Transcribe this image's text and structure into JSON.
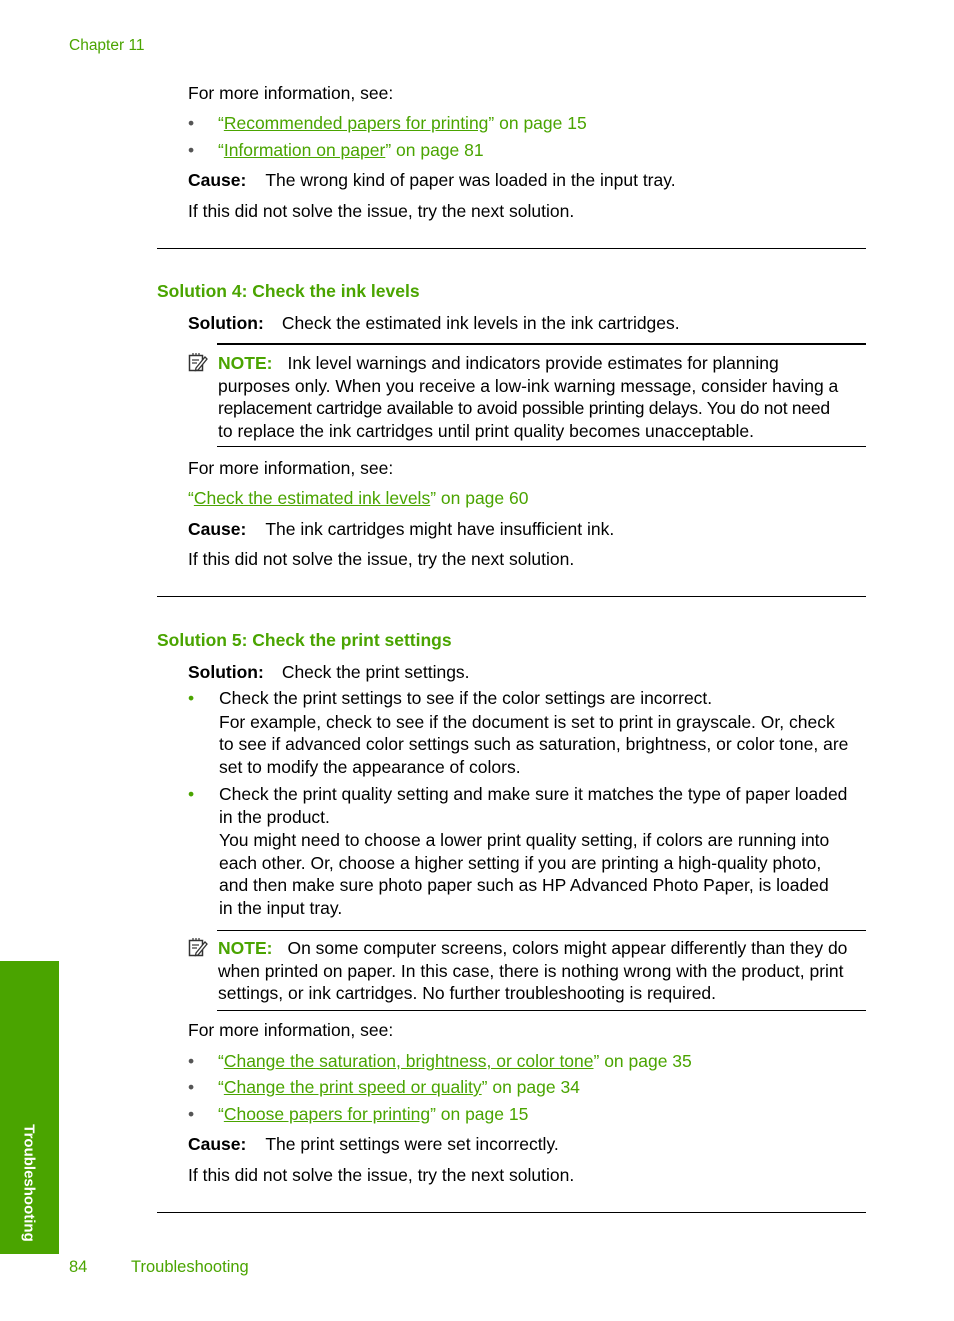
{
  "header": {
    "chapter": "Chapter 11"
  },
  "section_top": {
    "more_info": "For more information, see:",
    "links": [
      {
        "open": "“",
        "link": "Recommended papers for printing",
        "rest": "” on page 15"
      },
      {
        "open": "“",
        "link": "Information on paper",
        "rest": "” on page 81"
      }
    ],
    "cause_label": "Cause:",
    "cause_text": "The wrong kind of paper was loaded in the input tray.",
    "next": "If this did not solve the issue, try the next solution."
  },
  "solution4": {
    "heading": "Solution 4: Check the ink levels",
    "solution_label": "Solution:",
    "solution_text": "Check the estimated ink levels in the ink cartridges.",
    "note_label": "NOTE:",
    "note_lines": [
      "Ink level warnings and indicators provide estimates for planning",
      "purposes only. When you receive a low-ink warning message, consider having a",
      "replacement cartridge available to avoid possible printing delays. You do not need",
      "to replace the ink cartridges until print quality becomes unacceptable."
    ],
    "more_info": "For more information, see:",
    "link": {
      "open": "“",
      "link": "Check the estimated ink levels",
      "rest": "” on page 60"
    },
    "cause_label": "Cause:",
    "cause_text": "The ink cartridges might have insufficient ink.",
    "next": "If this did not solve the issue, try the next solution."
  },
  "solution5": {
    "heading": "Solution 5: Check the print settings",
    "solution_label": "Solution:",
    "solution_text": "Check the print settings.",
    "bullets": [
      {
        "first": "Check the print settings to see if the color settings are incorrect.",
        "detail": [
          "For example, check to see if the document is set to print in grayscale. Or, check",
          "to see if advanced color settings such as saturation, brightness, or color tone, are",
          "set to modify the appearance of colors."
        ]
      },
      {
        "first_lines": [
          "Check the print quality setting and make sure it matches the type of paper loaded",
          "in the product."
        ],
        "detail": [
          "You might need to choose a lower print quality setting, if colors are running into",
          "each other. Or, choose a higher setting if you are printing a high-quality photo,",
          "and then make sure photo paper such as HP Advanced Photo Paper, is loaded",
          "in the input tray."
        ]
      }
    ],
    "note_label": "NOTE:",
    "note_lines": [
      "On some computer screens, colors might appear differently than they do",
      "when printed on paper. In this case, there is nothing wrong with the product, print",
      "settings, or ink cartridges. No further troubleshooting is required."
    ],
    "more_info": "For more information, see:",
    "links": [
      {
        "open": "“",
        "link": "Change the saturation, brightness, or color tone",
        "rest": "” on page 35"
      },
      {
        "open": "“",
        "link": "Change the print speed or quality",
        "rest": "” on page 34"
      },
      {
        "open": "“",
        "link": "Choose papers for printing",
        "rest": "” on page 15"
      }
    ],
    "cause_label": "Cause:",
    "cause_text": "The print settings were set incorrectly.",
    "next": "If this did not solve the issue, try the next solution."
  },
  "side_tab": {
    "label": "Troubleshooting"
  },
  "footer": {
    "page_number": "84",
    "section": "Troubleshooting"
  },
  "icons": {
    "bullet": "•",
    "note": "note-pencil-icon"
  },
  "colors": {
    "accent": "#4aa400",
    "text": "#000000"
  }
}
